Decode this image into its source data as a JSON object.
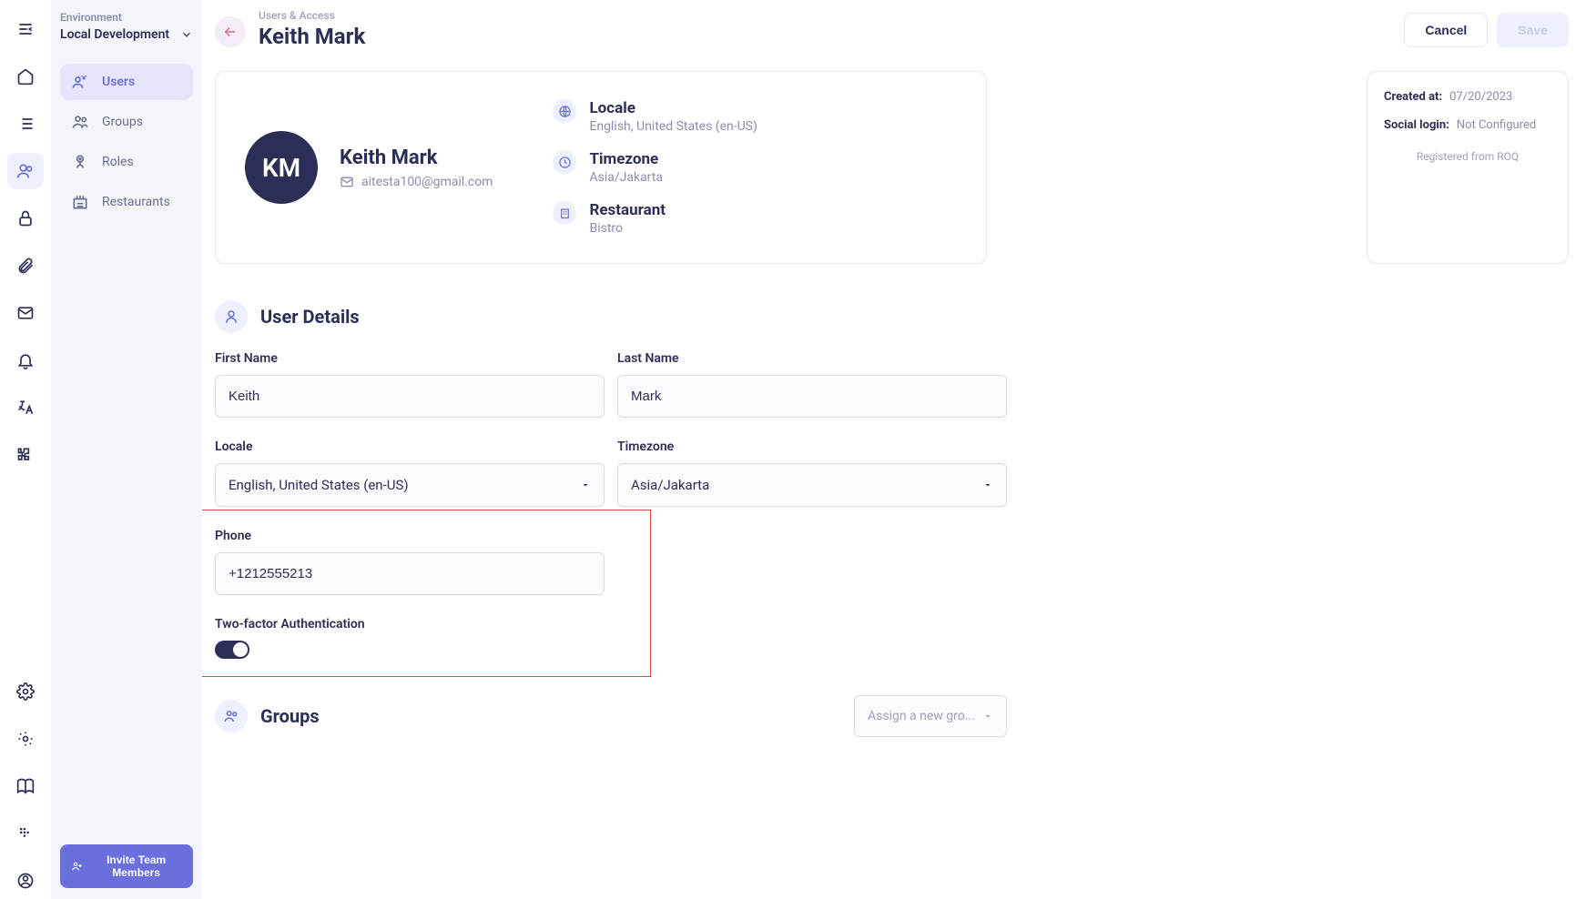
{
  "env": {
    "label": "Environment",
    "value": "Local Development"
  },
  "sidebar": {
    "items": [
      {
        "label": "Users"
      },
      {
        "label": "Groups"
      },
      {
        "label": "Roles"
      },
      {
        "label": "Restaurants"
      }
    ],
    "invite_label": "Invite Team Members"
  },
  "header": {
    "breadcrumb": "Users & Access",
    "title": "Keith Mark",
    "cancel": "Cancel",
    "save": "Save"
  },
  "summary": {
    "initials": "KM",
    "name": "Keith Mark",
    "email": "aitesta100@gmail.com",
    "locale_label": "Locale",
    "locale_value": "English, United States (en-US)",
    "tz_label": "Timezone",
    "tz_value": "Asia/Jakarta",
    "restaurant_label": "Restaurant",
    "restaurant_value": "Bistro"
  },
  "info": {
    "created_at_label": "Created at:",
    "created_at_value": "07/20/2023",
    "social_label": "Social login:",
    "social_value": "Not Configured",
    "registered": "Registered from ROQ"
  },
  "details": {
    "section_title": "User Details",
    "first_name_label": "First Name",
    "first_name_value": "Keith",
    "last_name_label": "Last Name",
    "last_name_value": "Mark",
    "locale_label": "Locale",
    "locale_value": "English, United States (en-US)",
    "timezone_label": "Timezone",
    "timezone_value": "Asia/Jakarta",
    "phone_label": "Phone",
    "phone_value": "+1212555213",
    "twofa_label": "Two-factor Authentication"
  },
  "groups": {
    "section_title": "Groups",
    "assign_placeholder": "Assign a new gro..."
  }
}
